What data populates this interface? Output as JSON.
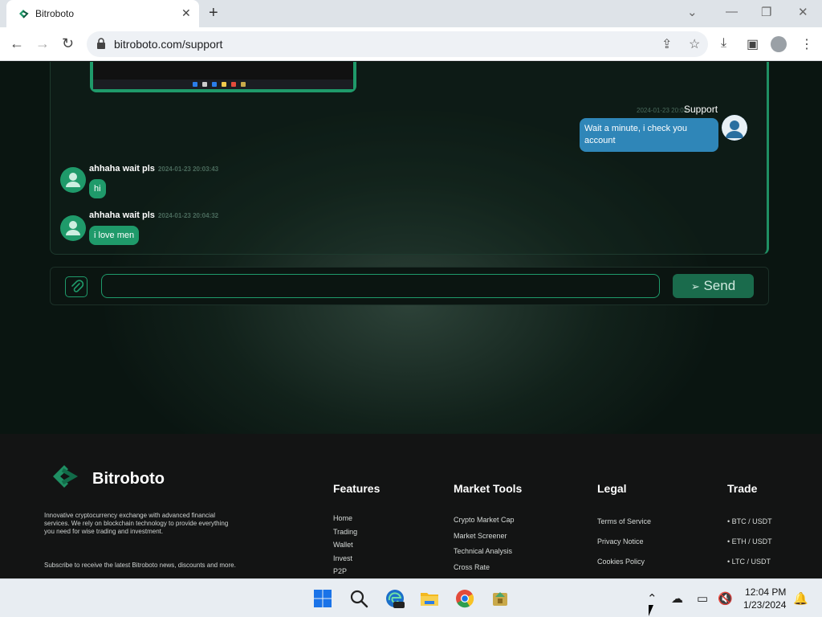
{
  "browser": {
    "tab_title": "Bitroboto",
    "new_tab": "+",
    "url": "bitroboto.com/support"
  },
  "chat": {
    "support_message": {
      "name": "Support",
      "time": "2024-01-23 20:03",
      "text": "Wait a minute, i check you account"
    },
    "user_messages": [
      {
        "name": "ahhaha wait pls",
        "time": "2024-01-23 20:03:43",
        "text": "hi"
      },
      {
        "name": "ahhaha wait pls",
        "time": "2024-01-23 20:04:32",
        "text": "i love men"
      }
    ],
    "input_value": "",
    "send_label": "Send"
  },
  "footer": {
    "brand": "Bitroboto",
    "description": "Innovative cryptocurrency exchange with advanced financial services. We rely on blockchain technology to provide everything you need for wise trading and investment.",
    "subscribe": "Subscribe to receive the latest Bitroboto news, discounts and more.",
    "columns": [
      {
        "title": "Features",
        "links": [
          "Home",
          "Trading",
          "Wallet",
          "Invest",
          "P2P"
        ]
      },
      {
        "title": "Market Tools",
        "links": [
          "Crypto Market Cap",
          "Market Screener",
          "Technical Analysis",
          "Cross Rate"
        ]
      },
      {
        "title": "Legal",
        "links": [
          "Terms of Service",
          "Privacy Notice",
          "Cookies Policy"
        ]
      },
      {
        "title": "Trade",
        "links": [
          "• BTC / USDT",
          "• ETH / USDT",
          "• LTC / USDT"
        ]
      }
    ]
  },
  "taskbar": {
    "time": "12:04 PM",
    "date": "1/23/2024"
  },
  "colors": {
    "accent": "#1f9a6a",
    "support_bubble": "#2f86b8",
    "page_bg": "#0a1511",
    "footer_bg": "#131414"
  }
}
